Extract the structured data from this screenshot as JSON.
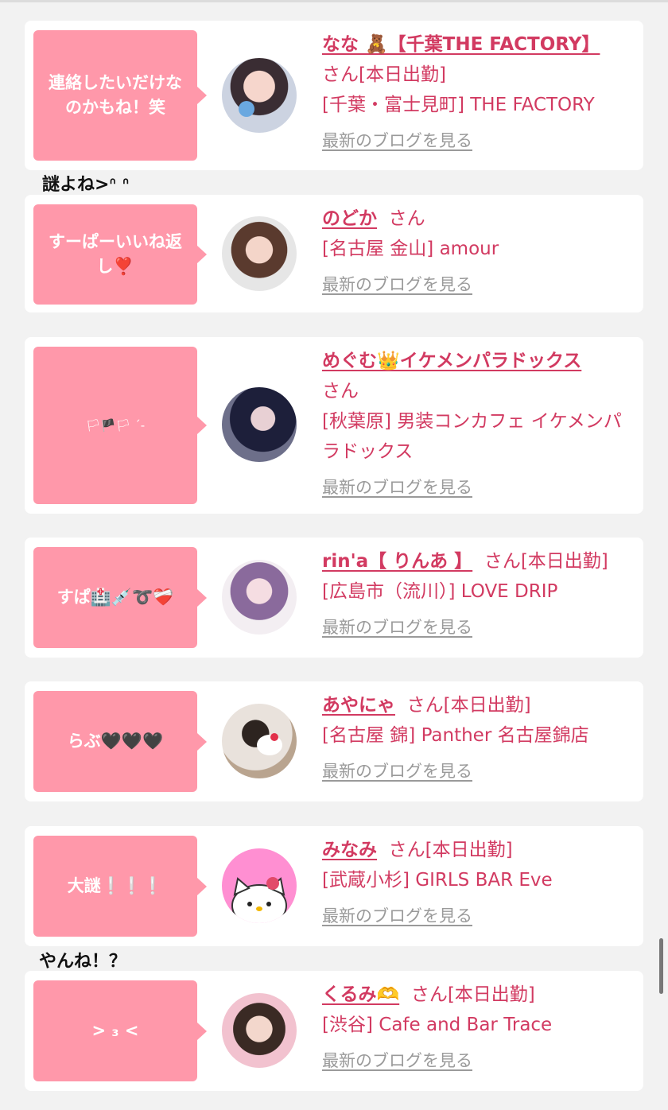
{
  "cards": [
    {
      "bubble_text": "連絡したいだけなのかもね！笑",
      "name": "なな 🧸【千葉THE FACTORY】",
      "suffix": "さん[本日出勤]",
      "shop": "[千葉・富士見町] THE FACTORY",
      "blog_link": "最新のブログを見る"
    },
    {
      "bubble_text": "すーぱーいいね返し❣️",
      "name": "のどか",
      "suffix": "さん",
      "shop": "[名古屋 金山] amour",
      "blog_link": "最新のブログを見る"
    },
    {
      "bubble_text": "🏳🏴🏳 ´-",
      "name": "めぐむ👑イケメンパラドックス",
      "suffix": "さん",
      "shop": "[秋葉原] 男装コンカフェ イケメンパラドックス",
      "blog_link": "最新のブログを見る"
    },
    {
      "bubble_text": "すぱ🏥💉➰❤️‍🩹",
      "name": "rin'a【 りんあ 】",
      "suffix": "さん[本日出勤]",
      "shop": "[広島市（流川）] LOVE DRIP",
      "blog_link": "最新のブログを見る"
    },
    {
      "bubble_text": "らぶ🖤🖤🖤",
      "name": "あやにゃ",
      "suffix": "さん[本日出勤]",
      "shop": "[名古屋 錦] Panther 名古屋錦店",
      "blog_link": "最新のブログを見る"
    },
    {
      "bubble_text": "大謎❕❕❕",
      "name": "みなみ",
      "suffix": "さん[本日出勤]",
      "shop": "[武蔵小杉] GIRLS BAR Eve",
      "blog_link": "最新のブログを見る"
    },
    {
      "bubble_text": "> ₃ <",
      "name": "くるみ🫶",
      "suffix": "さん[本日出勤]",
      "shop": "[渋谷] Cafe and Bar Trace",
      "blog_link": "最新のブログを見る"
    }
  ],
  "overflow_texts": [
    "謎よね>ᐢ ᐢ",
    "やんね！？"
  ],
  "colors": {
    "accent": "#d23a61",
    "bubble": "#ff98aa",
    "link": "#9a9a9a",
    "background": "#f2f2f2"
  },
  "avatars": [
    "avatar-photo",
    "avatar-photo",
    "avatar-photo",
    "avatar-photo",
    "avatar-photo",
    "hello-kitty-avatar",
    "avatar-photo"
  ]
}
